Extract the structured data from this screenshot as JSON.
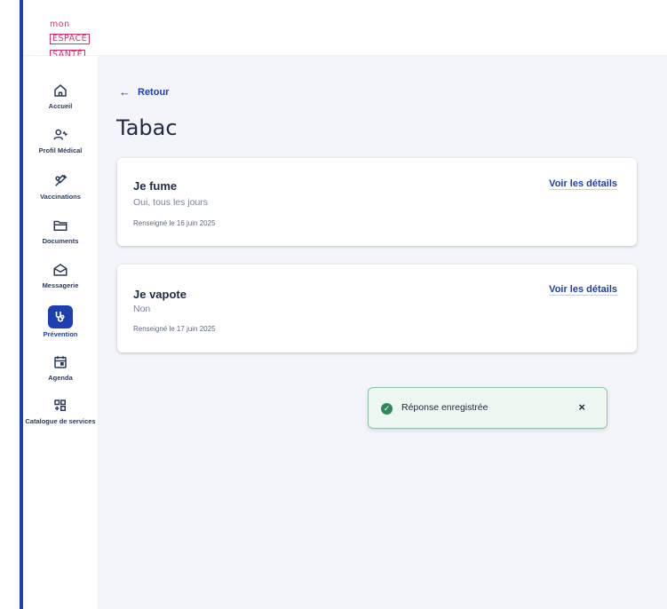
{
  "logo": {
    "line1": "mon",
    "line2": "ESPACE",
    "line3": "SANTÉ"
  },
  "sidebar": {
    "items": [
      {
        "label": "Accueil",
        "icon": "home-icon"
      },
      {
        "label": "Profil Médical",
        "icon": "profile-medical-icon"
      },
      {
        "label": "Vaccinations",
        "icon": "vaccination-icon"
      },
      {
        "label": "Documents",
        "icon": "folder-icon"
      },
      {
        "label": "Messagerie",
        "icon": "envelope-icon"
      },
      {
        "label": "Prévention",
        "icon": "stethoscope-icon",
        "active": true
      },
      {
        "label": "Agenda",
        "icon": "calendar-icon"
      },
      {
        "label": "Catalogue de services",
        "icon": "catalogue-icon"
      }
    ]
  },
  "main": {
    "back_label": "Retour",
    "title": "Tabac",
    "cards": [
      {
        "title": "Je fume",
        "value": "Oui, tous les jours",
        "date": "Renseigné le 16 juin 2025",
        "link": "Voir les détails"
      },
      {
        "title": "Je vapote",
        "value": "Non",
        "date": "Renseigné le 17 juin 2025",
        "link": "Voir les détails"
      }
    ]
  },
  "toast": {
    "message": "Réponse enregistrée",
    "close": "×"
  },
  "colors": {
    "accent": "#1e40af",
    "success": "#2f8a5a",
    "brand": "#d6336c",
    "background": "#f3f5fa"
  }
}
